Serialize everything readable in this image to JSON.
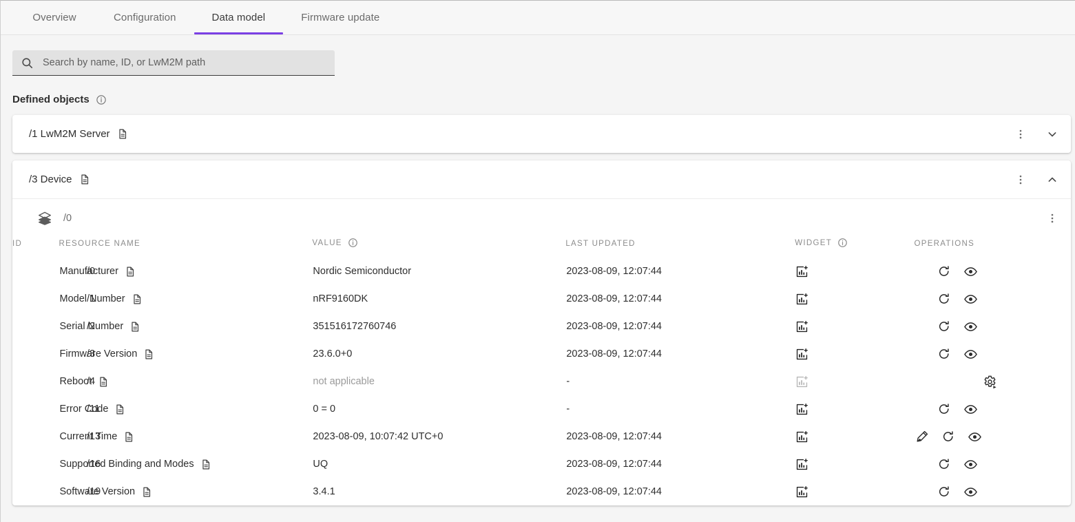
{
  "tabs": [
    {
      "label": "Overview",
      "active": false
    },
    {
      "label": "Configuration",
      "active": false
    },
    {
      "label": "Data model",
      "active": true
    },
    {
      "label": "Firmware update",
      "active": false
    }
  ],
  "search": {
    "placeholder": "Search by name, ID, or LwM2M path",
    "value": "",
    "icon": "search-icon"
  },
  "section": {
    "title": "Defined objects",
    "info_icon": "info-icon"
  },
  "accent_color": "#7b3fe4",
  "objects": [
    {
      "path_label": "/1 LwM2M Server",
      "doc_icon": "document-icon",
      "menu_icon": "more-vertical-icon",
      "toggle_icon": "chevron-down-icon",
      "expanded": false
    },
    {
      "path_label": "/3 Device",
      "doc_icon": "document-icon",
      "menu_icon": "more-vertical-icon",
      "toggle_icon": "chevron-up-icon",
      "expanded": true,
      "instance": {
        "layers_icon": "layers-icon",
        "path_label": "/0",
        "menu_icon": "more-vertical-icon",
        "columns": [
          {
            "key": "id",
            "label": "ID"
          },
          {
            "key": "name",
            "label": "RESOURCE NAME"
          },
          {
            "key": "value",
            "label": "VALUE",
            "info_icon": "info-icon"
          },
          {
            "key": "updated",
            "label": "LAST UPDATED"
          },
          {
            "key": "widget",
            "label": "WIDGET",
            "info_icon": "info-icon"
          },
          {
            "key": "ops",
            "label": "OPERATIONS"
          }
        ],
        "rows": [
          {
            "id": "/0",
            "name": "Manufacturer",
            "value": "Nordic Semiconductor",
            "value_muted": false,
            "updated": "2023-08-09, 12:07:44",
            "widget": "add-chart-icon",
            "widget_enabled": true,
            "ops": [
              "refresh-icon",
              "observe-eye-icon"
            ]
          },
          {
            "id": "/1",
            "name": "Model Number",
            "value": "nRF9160DK",
            "value_muted": false,
            "updated": "2023-08-09, 12:07:44",
            "widget": "add-chart-icon",
            "widget_enabled": true,
            "ops": [
              "refresh-icon",
              "observe-eye-icon"
            ]
          },
          {
            "id": "/2",
            "name": "Serial Number",
            "value": "351516172760746",
            "value_muted": false,
            "updated": "2023-08-09, 12:07:44",
            "widget": "add-chart-icon",
            "widget_enabled": true,
            "ops": [
              "refresh-icon",
              "observe-eye-icon"
            ]
          },
          {
            "id": "/3",
            "name": "Firmware Version",
            "value": "23.6.0+0",
            "value_muted": false,
            "updated": "2023-08-09, 12:07:44",
            "widget": "add-chart-icon",
            "widget_enabled": true,
            "ops": [
              "refresh-icon",
              "observe-eye-icon"
            ]
          },
          {
            "id": "/4",
            "name": "Reboot",
            "value": "not applicable",
            "value_muted": true,
            "updated": "-",
            "widget": "add-chart-icon",
            "widget_enabled": false,
            "ops": [
              "execute-gear-icon"
            ]
          },
          {
            "id": "/11",
            "name": "Error Code",
            "value": "0 = 0",
            "value_muted": false,
            "updated": "-",
            "widget": "add-chart-icon",
            "widget_enabled": true,
            "ops": [
              "refresh-icon",
              "observe-eye-icon"
            ]
          },
          {
            "id": "/13",
            "name": "Current Time",
            "value": "2023-08-09, 10:07:42 UTC+0",
            "value_muted": false,
            "updated": "2023-08-09, 12:07:44",
            "widget": "add-chart-icon",
            "widget_enabled": true,
            "ops": [
              "edit-pencil-icon",
              "refresh-icon",
              "observe-eye-icon"
            ]
          },
          {
            "id": "/16",
            "name": "Supported Binding and Modes",
            "value": "UQ",
            "value_muted": false,
            "updated": "2023-08-09, 12:07:44",
            "widget": "add-chart-icon",
            "widget_enabled": true,
            "ops": [
              "refresh-icon",
              "observe-eye-icon"
            ]
          },
          {
            "id": "/19",
            "name": "Software Version",
            "value": "3.4.1",
            "value_muted": false,
            "updated": "2023-08-09, 12:07:44",
            "widget": "add-chart-icon",
            "widget_enabled": true,
            "ops": [
              "refresh-icon",
              "observe-eye-icon"
            ]
          }
        ]
      }
    }
  ]
}
